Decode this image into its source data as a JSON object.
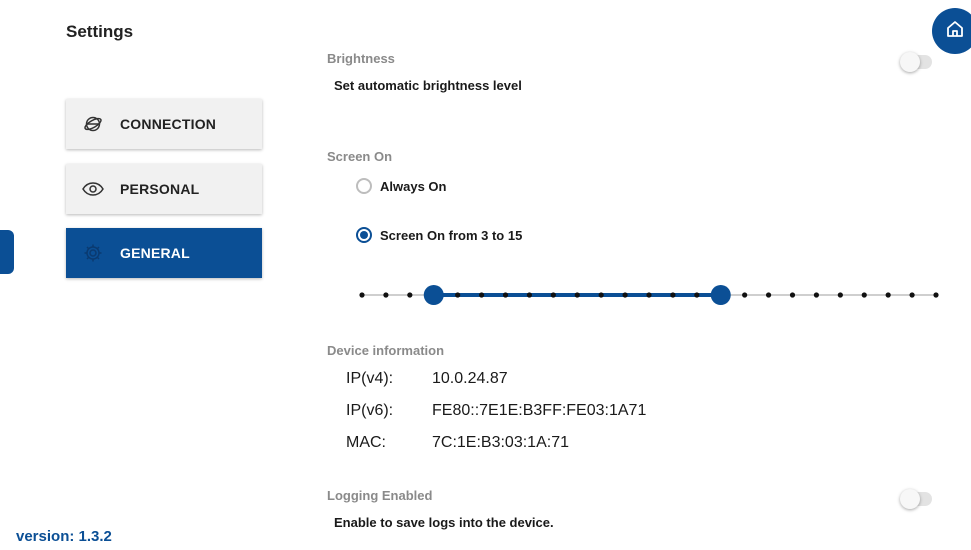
{
  "header": {
    "title": "Settings"
  },
  "nav": [
    {
      "label": "CONNECTION",
      "icon": "globe-network-icon",
      "active": false
    },
    {
      "label": "PERSONAL",
      "icon": "eye-icon",
      "active": false
    },
    {
      "label": "GENERAL",
      "icon": "gear-icon",
      "active": true
    }
  ],
  "footer": {
    "version": "version: 1.3.2"
  },
  "home": {
    "icon": "home-icon"
  },
  "brightness": {
    "label": "Brightness",
    "description": "Set automatic brightness level",
    "enabled": false
  },
  "screen_on": {
    "label": "Screen On",
    "options": [
      {
        "label": "Always On",
        "selected": false
      },
      {
        "label": "Screen On from 3 to 15",
        "selected": true
      }
    ],
    "range": {
      "min": 0,
      "max": 24,
      "start": 3,
      "end": 15
    }
  },
  "device_info": {
    "label": "Device information",
    "rows": [
      {
        "key": "IP(v4):",
        "value": "10.0.24.87"
      },
      {
        "key": "IP(v6):",
        "value": "FE80::7E1E:B3FF:FE03:1A71"
      },
      {
        "key": "MAC:",
        "value": "7C:1E:B3:03:1A:71"
      }
    ]
  },
  "logging": {
    "label": "Logging Enabled",
    "description": "Enable to save logs into the device.",
    "enabled": false
  },
  "colors": {
    "accent": "#0b4f95",
    "muted_label": "#8a8a8a"
  }
}
